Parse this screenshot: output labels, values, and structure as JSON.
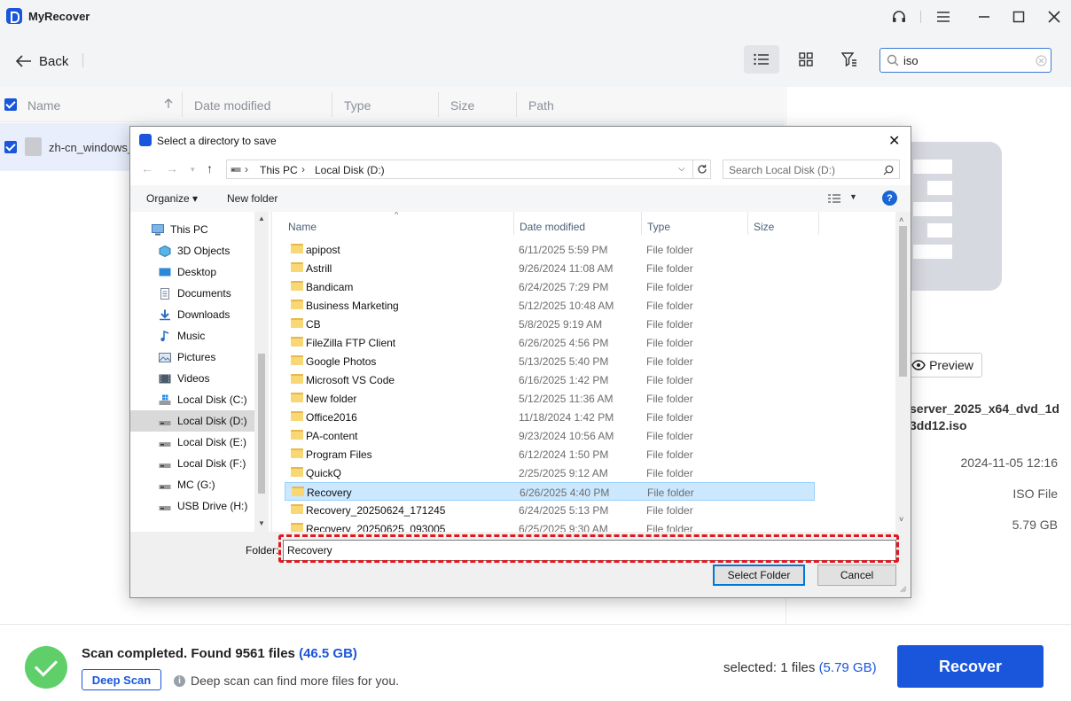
{
  "app": {
    "name": "MyRecover"
  },
  "toolbar": {
    "back_label": "Back",
    "search_value": "iso"
  },
  "list": {
    "columns": [
      "Name",
      "Date modified",
      "Type",
      "Size",
      "Path"
    ],
    "rows": [
      {
        "name": "zh-cn_windows_s"
      }
    ]
  },
  "details": {
    "preview_label": "Preview",
    "filename_line1": "server_2025_x64_dvd_1d",
    "filename_line2": "3dd12.iso",
    "date": "2024-11-05 12:16",
    "type": "ISO File",
    "size": "5.79 GB"
  },
  "dialog": {
    "title": "Select a directory to save",
    "breadcrumb": [
      "This PC",
      "Local Disk (D:)"
    ],
    "search_placeholder": "Search Local Disk (D:)",
    "organize_label": "Organize ▾",
    "new_folder_label": "New folder",
    "nav_items": [
      {
        "label": "This PC",
        "icon": "pc-icon"
      },
      {
        "label": "3D Objects",
        "icon": "cube-icon"
      },
      {
        "label": "Desktop",
        "icon": "desktop-icon"
      },
      {
        "label": "Documents",
        "icon": "document-icon"
      },
      {
        "label": "Downloads",
        "icon": "download-icon"
      },
      {
        "label": "Music",
        "icon": "music-icon"
      },
      {
        "label": "Pictures",
        "icon": "pictures-icon"
      },
      {
        "label": "Videos",
        "icon": "video-icon"
      },
      {
        "label": "Local Disk (C:)",
        "icon": "windows-drive-icon"
      },
      {
        "label": "Local Disk (D:)",
        "icon": "drive-icon",
        "selected": true
      },
      {
        "label": "Local Disk (E:)",
        "icon": "drive-icon"
      },
      {
        "label": "Local Disk (F:)",
        "icon": "drive-icon"
      },
      {
        "label": "MC (G:)",
        "icon": "drive-icon"
      },
      {
        "label": "USB Drive (H:)",
        "icon": "usb-drive-icon"
      }
    ],
    "columns": [
      "Name",
      "Date modified",
      "Type",
      "Size"
    ],
    "folders": [
      {
        "name": "apipost",
        "date": "6/11/2025 5:59 PM",
        "type": "File folder"
      },
      {
        "name": "Astrill",
        "date": "9/26/2024 11:08 AM",
        "type": "File folder"
      },
      {
        "name": "Bandicam",
        "date": "6/24/2025 7:29 PM",
        "type": "File folder"
      },
      {
        "name": "Business Marketing",
        "date": "5/12/2025 10:48 AM",
        "type": "File folder"
      },
      {
        "name": "CB",
        "date": "5/8/2025 9:19 AM",
        "type": "File folder"
      },
      {
        "name": "FileZilla FTP Client",
        "date": "6/26/2025 4:56 PM",
        "type": "File folder"
      },
      {
        "name": "Google Photos",
        "date": "5/13/2025 5:40 PM",
        "type": "File folder"
      },
      {
        "name": "Microsoft VS Code",
        "date": "6/16/2025 1:42 PM",
        "type": "File folder"
      },
      {
        "name": "New folder",
        "date": "5/12/2025 11:36 AM",
        "type": "File folder"
      },
      {
        "name": "Office2016",
        "date": "11/18/2024 1:42 PM",
        "type": "File folder"
      },
      {
        "name": "PA-content",
        "date": "9/23/2024 10:56 AM",
        "type": "File folder"
      },
      {
        "name": "Program Files",
        "date": "6/12/2024 1:50 PM",
        "type": "File folder"
      },
      {
        "name": "QuickQ",
        "date": "2/25/2025 9:12 AM",
        "type": "File folder"
      },
      {
        "name": "Recovery",
        "date": "6/26/2025 4:40 PM",
        "type": "File folder",
        "selected": true
      },
      {
        "name": "Recovery_20250624_171245",
        "date": "6/24/2025 5:13 PM",
        "type": "File folder"
      },
      {
        "name": "Recovery_20250625_093005",
        "date": "6/25/2025 9:30 AM",
        "type": "File folder"
      }
    ],
    "folder_label": "Folder:",
    "folder_value": "Recovery",
    "select_button": "Select Folder",
    "cancel_button": "Cancel"
  },
  "status": {
    "scan_text": "Scan completed. Found 9561 files",
    "scan_size": "(46.5 GB)",
    "deep_scan_label": "Deep Scan",
    "deep_scan_hint": "Deep scan can find more files for you.",
    "selected_text": "selected: 1 files",
    "selected_size": "(5.79 GB)",
    "recover_label": "Recover"
  },
  "colors": {
    "accent": "#1a56db",
    "success": "#5fcf6a",
    "highlight": "#e0191f"
  }
}
